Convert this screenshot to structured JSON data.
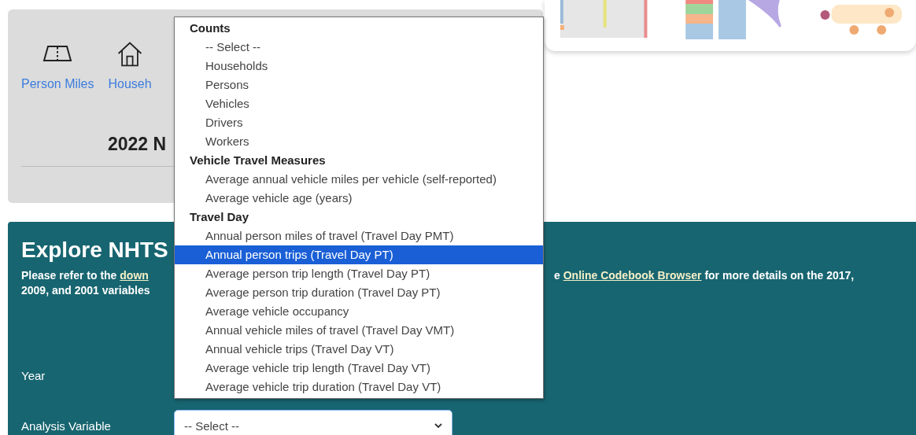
{
  "overview": {
    "links": [
      {
        "label": "Person Miles",
        "kind": "road"
      },
      {
        "label": "Househ",
        "kind": "house"
      }
    ],
    "title": "2022 N"
  },
  "explore": {
    "heading": "Explore NHTS",
    "note_left": [
      {
        "text": "Please refer to the ",
        "kind": "text"
      },
      {
        "text": "down",
        "kind": "link"
      }
    ],
    "note_right": [
      {
        "text": "e ",
        "kind": "text"
      },
      {
        "text": "Online Codebook Browser",
        "kind": "link"
      },
      {
        "text": " for more details on the 2017,",
        "kind": "text"
      }
    ],
    "note_line2": "2009, and 2001 variables",
    "fields": [
      {
        "label": "Year"
      },
      {
        "label": "Analysis Variable",
        "value": "-- Select --"
      }
    ]
  },
  "dropdown": {
    "groups": [
      {
        "label": "Counts",
        "options": [
          {
            "label": "-- Select --",
            "selected": false
          },
          {
            "label": "Households",
            "selected": false
          },
          {
            "label": "Persons",
            "selected": false
          },
          {
            "label": "Vehicles",
            "selected": false
          },
          {
            "label": "Drivers",
            "selected": false
          },
          {
            "label": "Workers",
            "selected": false
          }
        ]
      },
      {
        "label": "Vehicle Travel Measures",
        "options": [
          {
            "label": "Average annual vehicle miles per vehicle (self-reported)",
            "selected": false
          },
          {
            "label": "Average vehicle age (years)",
            "selected": false
          }
        ]
      },
      {
        "label": "Travel Day",
        "options": [
          {
            "label": "Annual person miles of travel (Travel Day PMT)",
            "selected": false
          },
          {
            "label": "Annual person trips (Travel Day PT)",
            "selected": true
          },
          {
            "label": "Average person trip length (Travel Day PT)",
            "selected": false
          },
          {
            "label": "Average person trip duration (Travel Day PT)",
            "selected": false
          },
          {
            "label": "Average vehicle occupancy",
            "selected": false
          },
          {
            "label": "Annual vehicle miles of travel (Travel Day VMT)",
            "selected": false
          },
          {
            "label": "Annual vehicle trips (Travel Day VT)",
            "selected": false
          },
          {
            "label": "Average vehicle trip length (Travel Day VT)",
            "selected": false
          },
          {
            "label": "Average vehicle trip duration (Travel Day VT)",
            "selected": false
          }
        ]
      }
    ]
  }
}
